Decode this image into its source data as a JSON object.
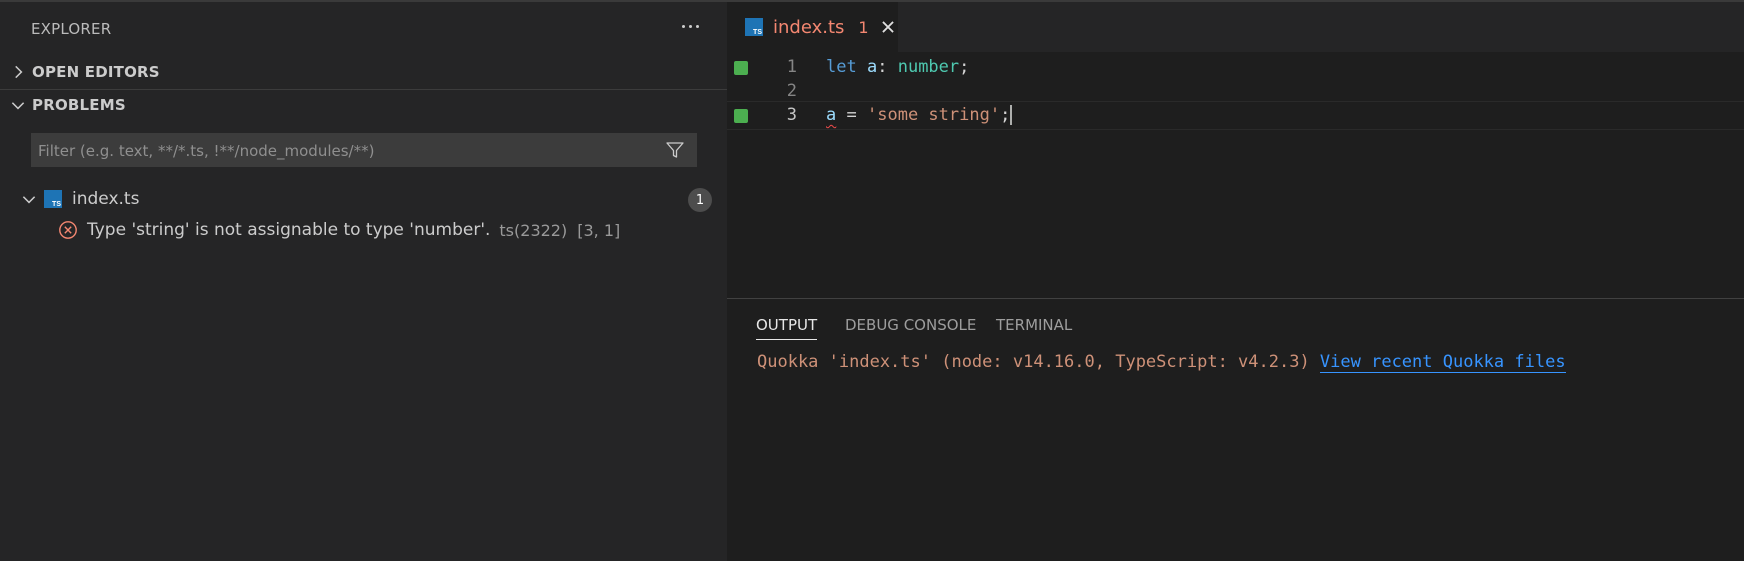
{
  "sidebar": {
    "title": "EXPLORER",
    "open_editors_label": "OPEN EDITORS",
    "problems_label": "PROBLEMS",
    "filter_placeholder": "Filter (e.g. text, **/*.ts, !**/node_modules/**)",
    "problem_file": {
      "icon_text": "TS",
      "name": "index.ts",
      "count": "1"
    },
    "problem": {
      "message": "Type 'string' is not assignable to type 'number'.",
      "code": "ts(2322)",
      "position": "[3, 1]"
    }
  },
  "editor": {
    "tab": {
      "icon_text": "TS",
      "label": "index.ts",
      "count": "1"
    },
    "lines": [
      {
        "number": "1",
        "tokens": [
          "let",
          "a",
          ":",
          "number",
          ";"
        ]
      },
      {
        "number": "2",
        "tokens": []
      },
      {
        "number": "3",
        "tokens": [
          "a",
          "=",
          "'some string'",
          ";"
        ]
      }
    ]
  },
  "panel": {
    "tabs": [
      "OUTPUT",
      "DEBUG CONSOLE",
      "TERMINAL"
    ],
    "active_tab": "OUTPUT",
    "output_text": "Quokka 'index.ts' (node: v14.16.0, TypeScript: v4.2.3) ",
    "output_link": "View recent Quokka files"
  },
  "colors": {
    "error": "#f48771",
    "keyword": "#569cd6",
    "type": "#4ec9b0",
    "string": "#ce9178",
    "link": "#3794ff",
    "gutter_added": "#4caf50"
  },
  "icons": [
    "more-actions-icon",
    "chevron-right-icon",
    "chevron-down-icon",
    "filter-icon",
    "ts-file-icon",
    "error-icon",
    "close-icon"
  ]
}
